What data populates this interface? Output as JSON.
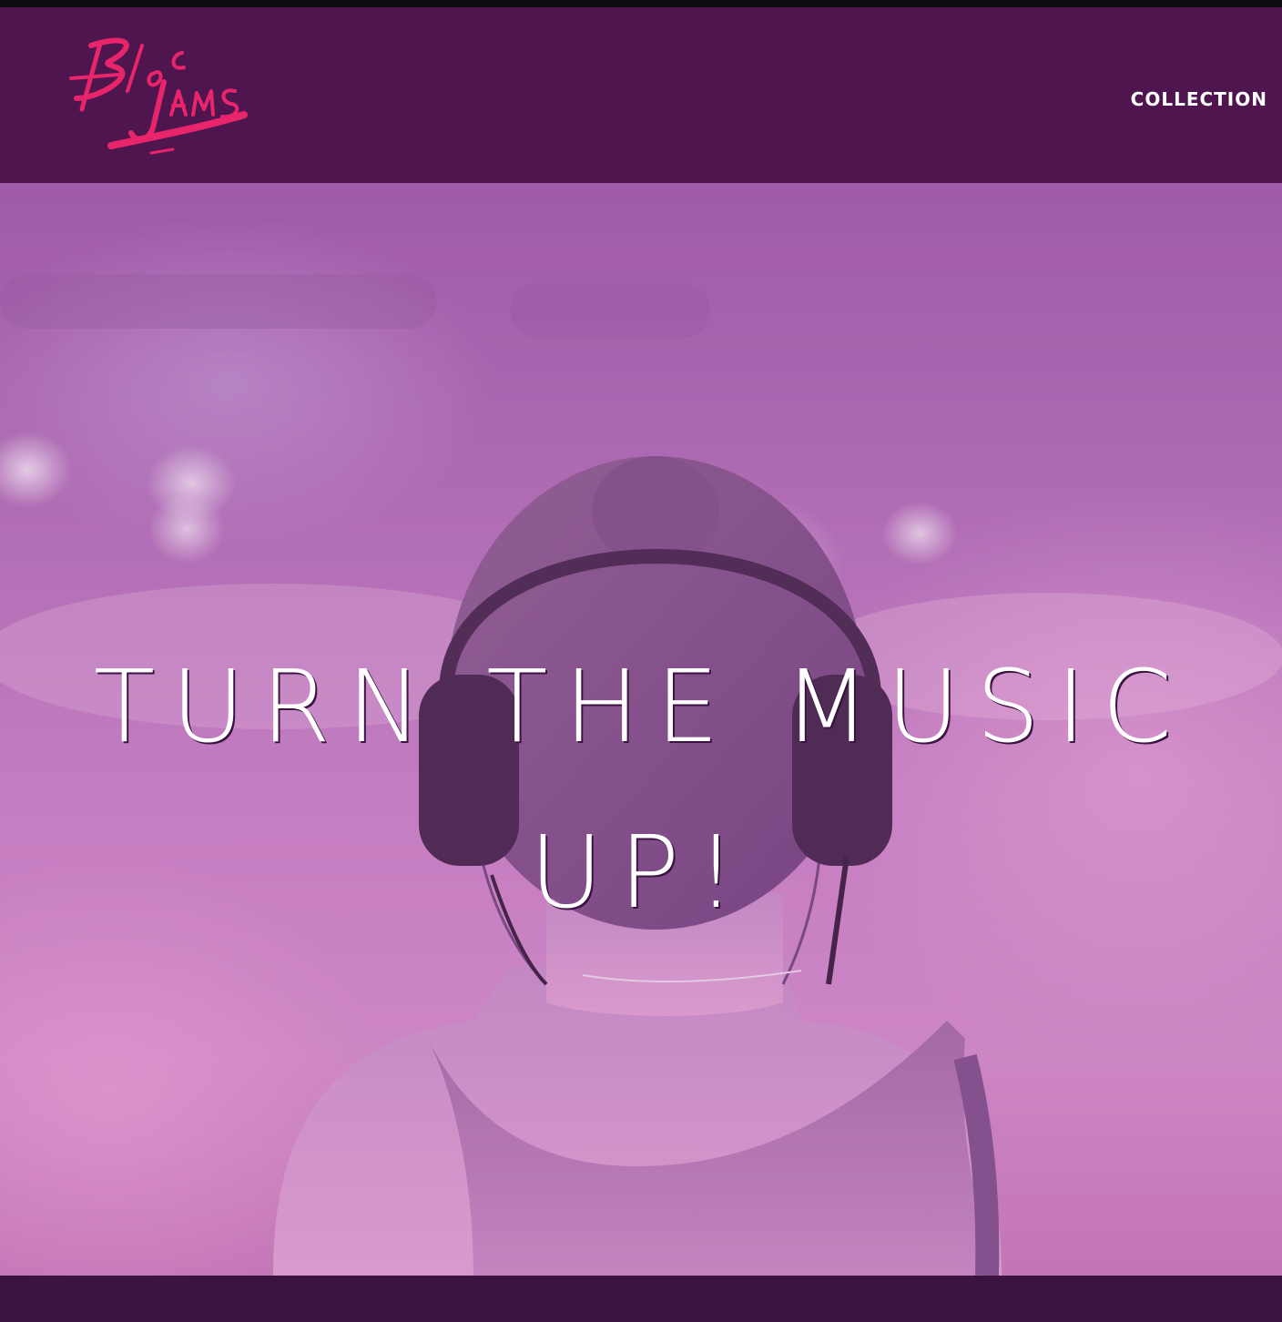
{
  "brand": {
    "logo_text": "Bloc Jams",
    "logo_color": "#e8246a"
  },
  "navbar": {
    "background": "#4e154f",
    "links": [
      {
        "label": "COLLECTION"
      }
    ]
  },
  "hero": {
    "headline_line1": "TURN THE MUSIC",
    "headline_line2": "UP!",
    "image_subject": "woman-with-headphones"
  },
  "footer": {
    "background": "#3a1340"
  }
}
